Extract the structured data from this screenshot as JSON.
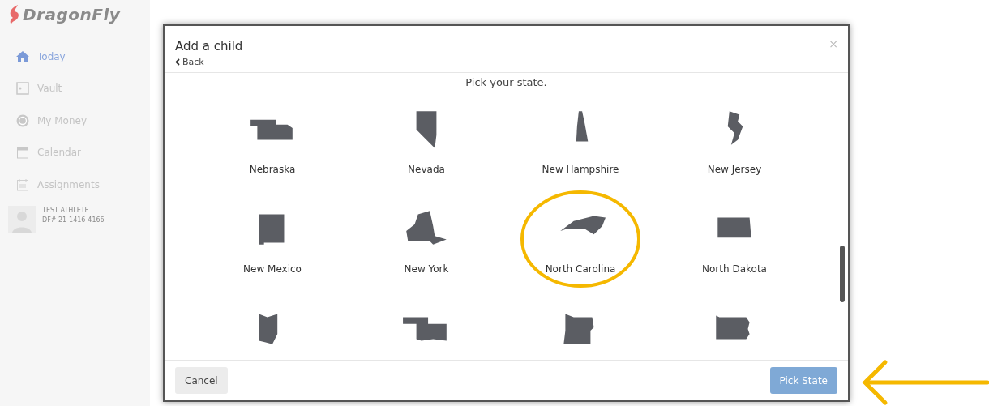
{
  "app": {
    "logo": "DragonFly"
  },
  "sidebar": {
    "items": [
      {
        "label": "Today",
        "selected": true
      },
      {
        "label": "Vault",
        "selected": false
      },
      {
        "label": "My Money",
        "selected": false
      },
      {
        "label": "Calendar",
        "selected": false
      },
      {
        "label": "Assignments",
        "selected": false
      }
    ],
    "user": {
      "name": "TEST ATHLETE",
      "id": "DF# 21-1416-4166"
    }
  },
  "dialog": {
    "title": "Add a child",
    "back": "Back",
    "close": "×",
    "prompt": "Pick your state.",
    "states": [
      {
        "label": "Nebraska",
        "highlighted": false
      },
      {
        "label": "Nevada",
        "highlighted": false
      },
      {
        "label": "New Hampshire",
        "highlighted": false
      },
      {
        "label": "New Jersey",
        "highlighted": false
      },
      {
        "label": "New Mexico",
        "highlighted": false
      },
      {
        "label": "New York",
        "highlighted": false
      },
      {
        "label": "North Carolina",
        "highlighted": true
      },
      {
        "label": "North Dakota",
        "highlighted": false
      },
      {
        "highlighted": false
      },
      {
        "highlighted": false
      },
      {
        "highlighted": false
      },
      {
        "highlighted": false
      }
    ],
    "buttons": [
      {
        "label": "Cancel",
        "kind": "secondary",
        "pointed": false
      },
      {
        "label": "Pick State",
        "kind": "primary",
        "pointed": true
      }
    ]
  }
}
